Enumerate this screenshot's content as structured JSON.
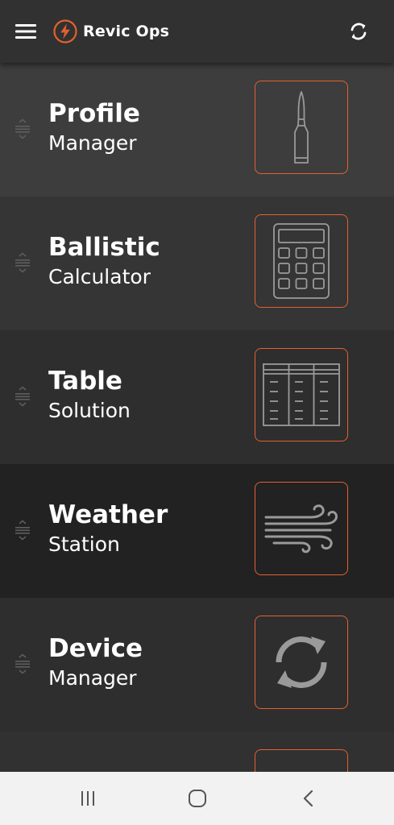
{
  "header": {
    "title": "Revic Ops",
    "menu_icon": "hamburger-menu-icon",
    "logo_icon": "revic-flame-logo-icon",
    "sync_icon": "sync-icon"
  },
  "menu_items": [
    {
      "title": "Profile",
      "subtitle": "Manager",
      "icon": "cartridge-icon",
      "background": "#3d3d3d"
    },
    {
      "title": "Ballistic",
      "subtitle": "Calculator",
      "icon": "calculator-icon",
      "background": "#353535"
    },
    {
      "title": "Table",
      "subtitle": "Solution",
      "icon": "table-icon",
      "background": "#2e2e2e"
    },
    {
      "title": "Weather",
      "subtitle": "Station",
      "icon": "wind-icon",
      "background": "#222222"
    },
    {
      "title": "Device",
      "subtitle": "Manager",
      "icon": "refresh-icon",
      "background": "#2e2e2e"
    },
    {
      "title": "",
      "subtitle": "",
      "icon": "",
      "background": "#313131"
    }
  ],
  "colors": {
    "accent": "#e2612f",
    "icon_stroke": "#9a9a9a",
    "text": "#ffffff",
    "navbar_bg": "#f2f2f2",
    "navbar_icon": "#555555"
  },
  "system_nav": {
    "recents_icon": "recent-apps-icon",
    "home_icon": "home-icon",
    "back_icon": "back-icon"
  }
}
